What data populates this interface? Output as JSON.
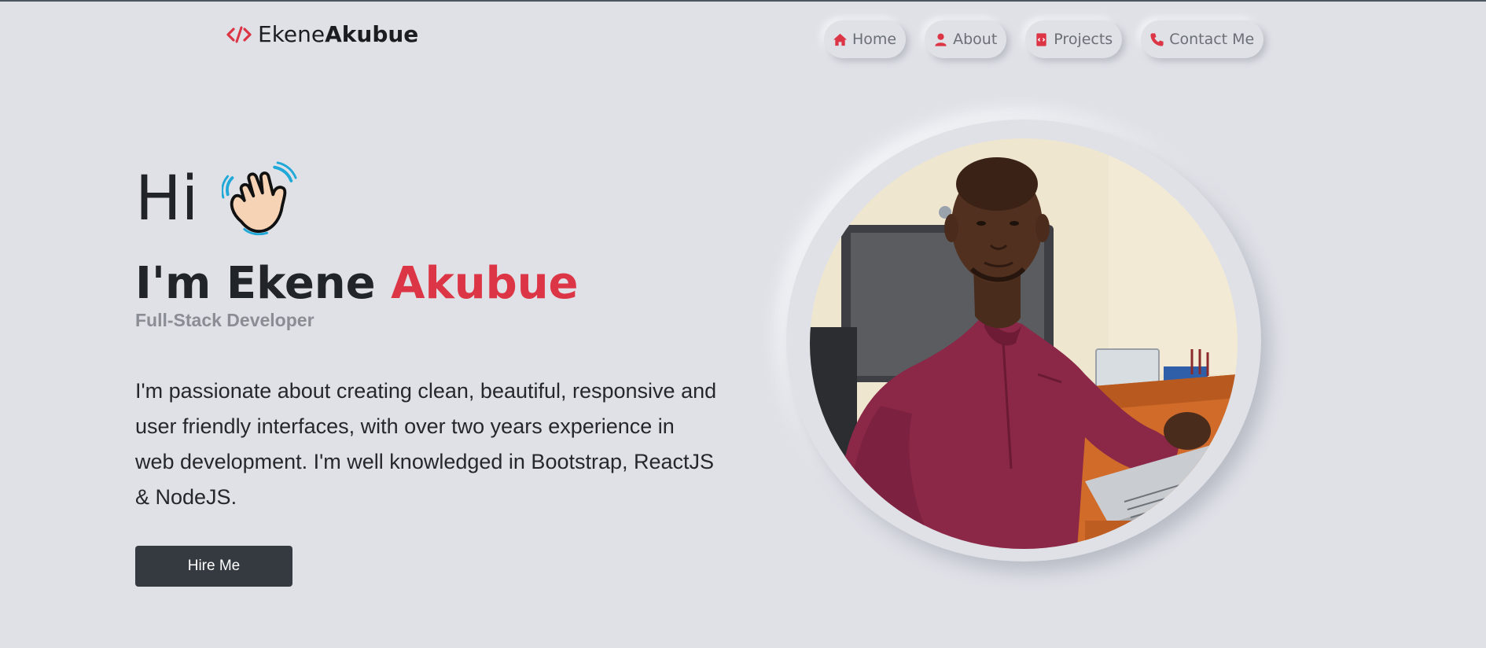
{
  "brand": {
    "first": "Ekene",
    "last": "Akubue",
    "icon": "code-icon",
    "accent": "#dc3545"
  },
  "nav": {
    "items": [
      {
        "label": "Home",
        "icon": "home-icon"
      },
      {
        "label": "About",
        "icon": "user-icon"
      },
      {
        "label": "Projects",
        "icon": "project-icon"
      },
      {
        "label": "Contact Me",
        "icon": "phone-icon"
      }
    ]
  },
  "hero": {
    "greeting": "Hi",
    "greeting_icon": "waving-hand-icon",
    "intro": "I'm Ekene",
    "name_accent": "Akubue",
    "role": "Full-Stack Developer",
    "bio": "I'm passionate about creating clean, beautiful, responsive and user friendly interfaces, with over two years experience in web development. I'm well knowledged in Bootstrap, ReactJS & NodeJS.",
    "cta_label": "Hire Me",
    "photo": "profile-photo"
  },
  "colors": {
    "background": "#dfe1e7",
    "accent": "#dc3545",
    "button": "#343a40"
  }
}
